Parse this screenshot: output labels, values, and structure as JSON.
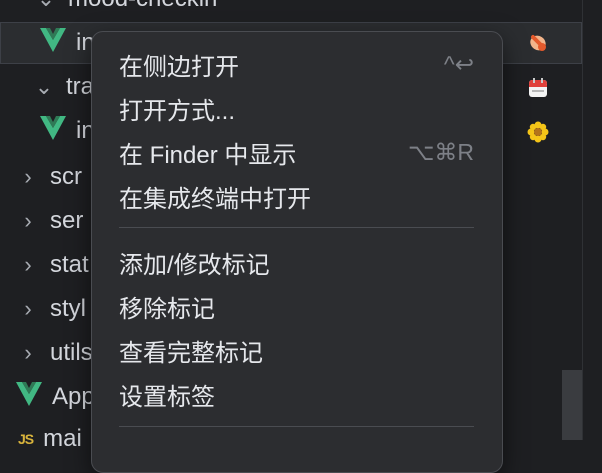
{
  "tree": {
    "rows": [
      {
        "kind": "folder-open",
        "label": "mood-checkin"
      },
      {
        "kind": "vue",
        "label": "in"
      },
      {
        "kind": "folder-open",
        "label": "tra"
      },
      {
        "kind": "vue",
        "label": "in"
      },
      {
        "kind": "folder",
        "label": "scr"
      },
      {
        "kind": "folder",
        "label": "ser"
      },
      {
        "kind": "folder",
        "label": "stat"
      },
      {
        "kind": "folder",
        "label": "styl"
      },
      {
        "kind": "folder",
        "label": "utils"
      },
      {
        "kind": "vue",
        "label": "App"
      },
      {
        "kind": "js",
        "label": "mai",
        "badge": "JS"
      }
    ]
  },
  "context_menu": {
    "group1": [
      {
        "label": "在侧边打开",
        "shortcut": "^↩"
      },
      {
        "label": "打开方式..."
      },
      {
        "label": "在 Finder 中显示",
        "shortcut": "⌥⌘R"
      },
      {
        "label": "在集成终端中打开"
      }
    ],
    "group2": [
      {
        "label": "添加/修改标记"
      },
      {
        "label": "移除标记"
      },
      {
        "label": "查看完整标记"
      },
      {
        "label": "设置标签"
      }
    ]
  },
  "icons": {
    "vue": "vue-logo-icon",
    "chevron_down": "chevron-down-icon",
    "chevron_right": "chevron-right-icon",
    "emoji1": "pointing-hand-emoji",
    "emoji2": "calendar-emoji",
    "emoji3": "flower-emoji"
  },
  "colors": {
    "vue_green": "#41b883",
    "vue_dark": "#2f7a56",
    "js_yellow": "#d9b43c",
    "menu_bg": "#2c2d30",
    "panel_bg": "#1e1f22"
  }
}
